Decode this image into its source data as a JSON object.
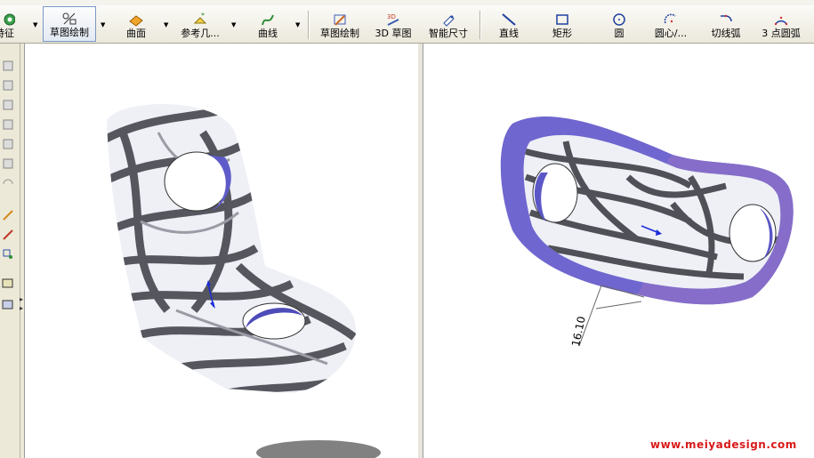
{
  "toolbar": {
    "features_label": "特征",
    "sketch_label": "草图绘制",
    "surfaces_label": "曲面",
    "ref_geometry_label": "参考几...",
    "curves_label": "曲线",
    "sketch2_label": "草图绘制",
    "sketch3d_label": "3D 草图",
    "smart_dim_label": "智能尺寸",
    "line_label": "直线",
    "rect_label": "矩形",
    "circle_label": "圆",
    "center_arc_label": "圆心/...",
    "tangent_arc_label": "切线弧",
    "three_pt_arc_label": "3 点圆弧"
  },
  "viewport_right": {
    "dimension_value": "16.10"
  },
  "watermark": "www.meiyadesign.com",
  "colors": {
    "window_bg": "#ece9d8",
    "face_purple": "#7268d0",
    "watermark_red": "#d91a1a"
  }
}
